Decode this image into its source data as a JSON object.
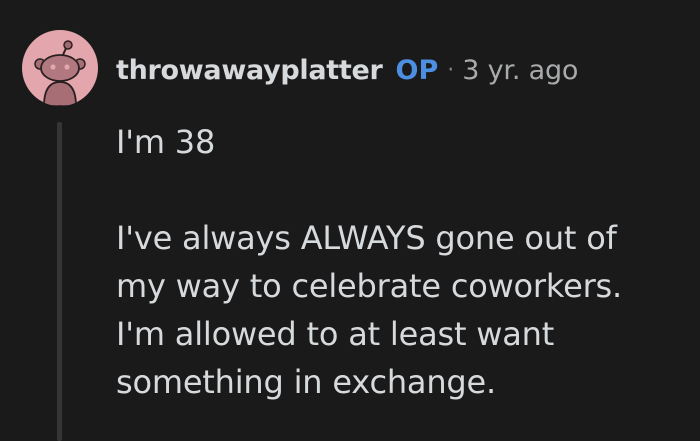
{
  "comment": {
    "author": "throwawayplatter",
    "op_badge": "OP",
    "separator": "·",
    "timestamp": "3 yr. ago",
    "avatar_icon": "snoo-avatar-icon",
    "colors": {
      "background": "#1a1a1b",
      "avatar_bg": "#e3a6ac",
      "op_blue": "#4c8fe0",
      "text": "#d7dadc"
    },
    "paragraphs": [
      [
        "I'm 38"
      ],
      [
        "I've always ALWAYS gone out of",
        "my way to celebrate coworkers.",
        "I'm allowed to at least want",
        "something in exchange."
      ]
    ]
  }
}
